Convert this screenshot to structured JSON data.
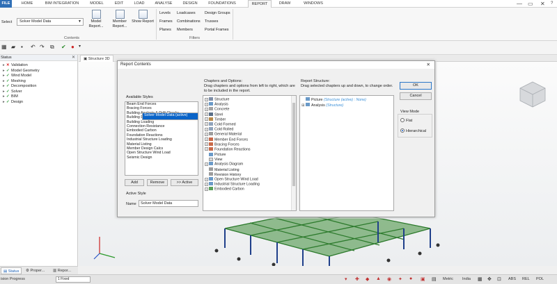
{
  "ribbon": {
    "tabs": [
      "FILE",
      "HOME",
      "BIM INTEGRATION",
      "MODEL",
      "EDIT",
      "LOAD",
      "ANALYSE",
      "DESIGN",
      "FOUNDATIONS",
      "REPORT",
      "DRAW",
      "WINDOWS"
    ],
    "active_tab": "REPORT",
    "select_label": "Select",
    "select_value": "Solver Model Data",
    "buttons": {
      "model_report": "Model Report...",
      "member_report": "Member Report...",
      "show_report": "Show Report"
    },
    "filters": {
      "col1": [
        "Levels",
        "Frames",
        "Planes"
      ],
      "col2": [
        "Loadcases",
        "Combinations",
        "Members"
      ],
      "col3": [
        "Design Groups",
        "Trusses",
        "Portal Frames"
      ]
    },
    "group_labels": {
      "contents": "Contents",
      "filters": "Filters"
    }
  },
  "status_panel": {
    "title": "Status",
    "items": [
      {
        "label": "Validation",
        "state": "error"
      },
      {
        "label": "Model Geometry",
        "state": "ok"
      },
      {
        "label": "Wind Model",
        "state": "ok"
      },
      {
        "label": "Meshing",
        "state": "ok"
      },
      {
        "label": "Decomposition",
        "state": "ok"
      },
      {
        "label": "Solver",
        "state": "ok"
      },
      {
        "label": "BIM",
        "state": "ok"
      },
      {
        "label": "Design",
        "state": "ok"
      }
    ]
  },
  "view": {
    "active_tab": "Structure 3D"
  },
  "dialog": {
    "title": "Report Contents",
    "available_styles_label": "Available Styles",
    "styles": [
      "Beam End Forces",
      "Bracing Forces",
      "Building Analysis & Drift Checks",
      "Building Design",
      "Building Loading",
      "Connection Resistance",
      "Embodied Carbon",
      "Foundation Reactions",
      "Industrial Structure Loading",
      "Material Listing",
      "Member Design Calcs",
      "Open Structure Wind Load",
      "Seismic Design",
      "Solver Model Data (active)"
    ],
    "selected_style": "Solver Model Data (active)",
    "add_label": "Add",
    "remove_label": "Remove",
    "active_label": ">> Active",
    "active_style_label": "Active Style",
    "name_label": "Name",
    "name_value": "Solver Model Data",
    "chapters_label": "Chapters and Options:",
    "chapters_help": "Drag chapters and options from left to right, which are to be included in the report.",
    "chapters": [
      "Structure",
      "Analysis",
      "Concrete",
      "Steel",
      "Timber",
      "Cold Formed",
      "Cold Rolled",
      "General Material",
      "Member End Forces",
      "Bracing Forces",
      "Foundation Reactions",
      "Picture",
      "View",
      "Analysis Diagram",
      "Material Listing",
      "Revision History",
      "Open Structure Wind Load",
      "Industrial Structure Loading",
      "Embodied Carbon"
    ],
    "structure_label": "Report Structure:",
    "structure_help": "Drag selected chapters up and down, to change order.",
    "structure_items": [
      {
        "label": "Picture",
        "note": "(Structure (active) : None)"
      },
      {
        "label": "Analysis",
        "note": "(Structure)"
      }
    ],
    "ok_label": "OK",
    "cancel_label": "Cancel",
    "view_mode_label": "View Mode",
    "view_modes": [
      "Flat",
      "Hierarchical"
    ],
    "selected_view_mode": "Hierarchical"
  },
  "bottom_tabs": [
    "Status",
    "Proper...",
    "Repor..."
  ],
  "statusbar": {
    "left": "ision Progress",
    "field": "1 Fixed",
    "units": "Metric",
    "region": "India",
    "right_labels": [
      "ABS",
      "REL",
      "POL"
    ]
  }
}
